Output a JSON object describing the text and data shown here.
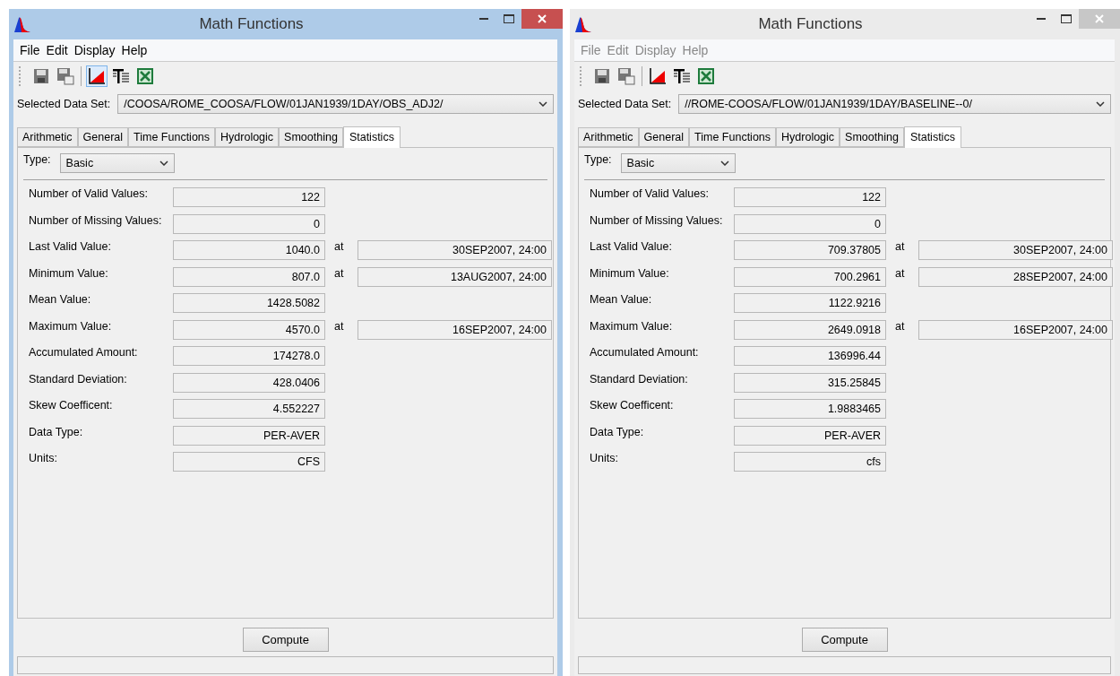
{
  "windows": [
    {
      "title": "Math Functions",
      "active": true,
      "menu": [
        {
          "label": "File",
          "disabled": false
        },
        {
          "label": "Edit",
          "disabled": false
        },
        {
          "label": "Display",
          "disabled": false
        },
        {
          "label": "Help",
          "disabled": false
        }
      ],
      "toolbar": [
        {
          "kind": "save",
          "selected": false
        },
        {
          "kind": "save-as",
          "selected": false
        },
        {
          "kind": "plot",
          "selected": true
        },
        {
          "kind": "table",
          "selected": false
        },
        {
          "kind": "excel",
          "selected": false
        }
      ],
      "dataset_label": "Selected Data Set:",
      "dataset": "/COOSA/ROME_COOSA/FLOW/01JAN1939/1DAY/OBS_ADJ2/",
      "tabs": [
        {
          "label": "Arithmetic",
          "selected": false
        },
        {
          "label": "General",
          "selected": false
        },
        {
          "label": "Time Functions",
          "selected": false
        },
        {
          "label": "Hydrologic",
          "selected": false
        },
        {
          "label": "Smoothing",
          "selected": false
        },
        {
          "label": "Statistics",
          "selected": true
        }
      ],
      "type_label": "Type:",
      "type": "Basic",
      "rows": [
        {
          "label": "Number of Valid Values:",
          "value": "122"
        },
        {
          "label": "Number of Missing Values:",
          "value": "0"
        },
        {
          "label": "Last Valid Value:",
          "value": "1040.0",
          "at": "at",
          "date": "30SEP2007, 24:00"
        },
        {
          "label": "Minimum Value:",
          "value": "807.0",
          "at": "at",
          "date": "13AUG2007, 24:00"
        },
        {
          "label": "Mean Value:",
          "value": "1428.5082"
        },
        {
          "label": "Maximum Value:",
          "value": "4570.0",
          "at": "at",
          "date": "16SEP2007, 24:00"
        },
        {
          "label": "Accumulated Amount:",
          "value": "174278.0"
        },
        {
          "label": "Standard Deviation:",
          "value": "428.0406"
        },
        {
          "label": "Skew Coefficent:",
          "value": "4.552227"
        },
        {
          "label": "Data Type:",
          "value": "PER-AVER"
        },
        {
          "label": "Units:",
          "value": "CFS"
        }
      ],
      "button": "Compute"
    },
    {
      "title": "Math Functions",
      "active": false,
      "menu": [
        {
          "label": "File",
          "disabled": true
        },
        {
          "label": "Edit",
          "disabled": true
        },
        {
          "label": "Display",
          "disabled": true
        },
        {
          "label": "Help",
          "disabled": true
        }
      ],
      "toolbar": [
        {
          "kind": "save",
          "selected": false
        },
        {
          "kind": "save-as",
          "selected": false
        },
        {
          "kind": "plot",
          "selected": false
        },
        {
          "kind": "table",
          "selected": false
        },
        {
          "kind": "excel",
          "selected": false
        }
      ],
      "dataset_label": "Selected Data Set:",
      "dataset": "//ROME-COOSA/FLOW/01JAN1939/1DAY/BASELINE--0/",
      "tabs": [
        {
          "label": "Arithmetic",
          "selected": false
        },
        {
          "label": "General",
          "selected": false
        },
        {
          "label": "Time Functions",
          "selected": false
        },
        {
          "label": "Hydrologic",
          "selected": false
        },
        {
          "label": "Smoothing",
          "selected": false
        },
        {
          "label": "Statistics",
          "selected": true
        }
      ],
      "type_label": "Type:",
      "type": "Basic",
      "rows": [
        {
          "label": "Number of Valid Values:",
          "value": "122"
        },
        {
          "label": "Number of Missing Values:",
          "value": "0"
        },
        {
          "label": "Last Valid Value:",
          "value": "709.37805",
          "at": "at",
          "date": "30SEP2007, 24:00"
        },
        {
          "label": "Minimum Value:",
          "value": "700.2961",
          "at": "at",
          "date": "28SEP2007, 24:00"
        },
        {
          "label": "Mean Value:",
          "value": "1122.9216"
        },
        {
          "label": "Maximum Value:",
          "value": "2649.0918",
          "at": "at",
          "date": "16SEP2007, 24:00"
        },
        {
          "label": "Accumulated Amount:",
          "value": "136996.44"
        },
        {
          "label": "Standard Deviation:",
          "value": "315.25845"
        },
        {
          "label": "Skew Coefficent:",
          "value": "1.9883465"
        },
        {
          "label": "Data Type:",
          "value": "PER-AVER"
        },
        {
          "label": "Units:",
          "value": "cfs"
        }
      ],
      "button": "Compute"
    }
  ]
}
